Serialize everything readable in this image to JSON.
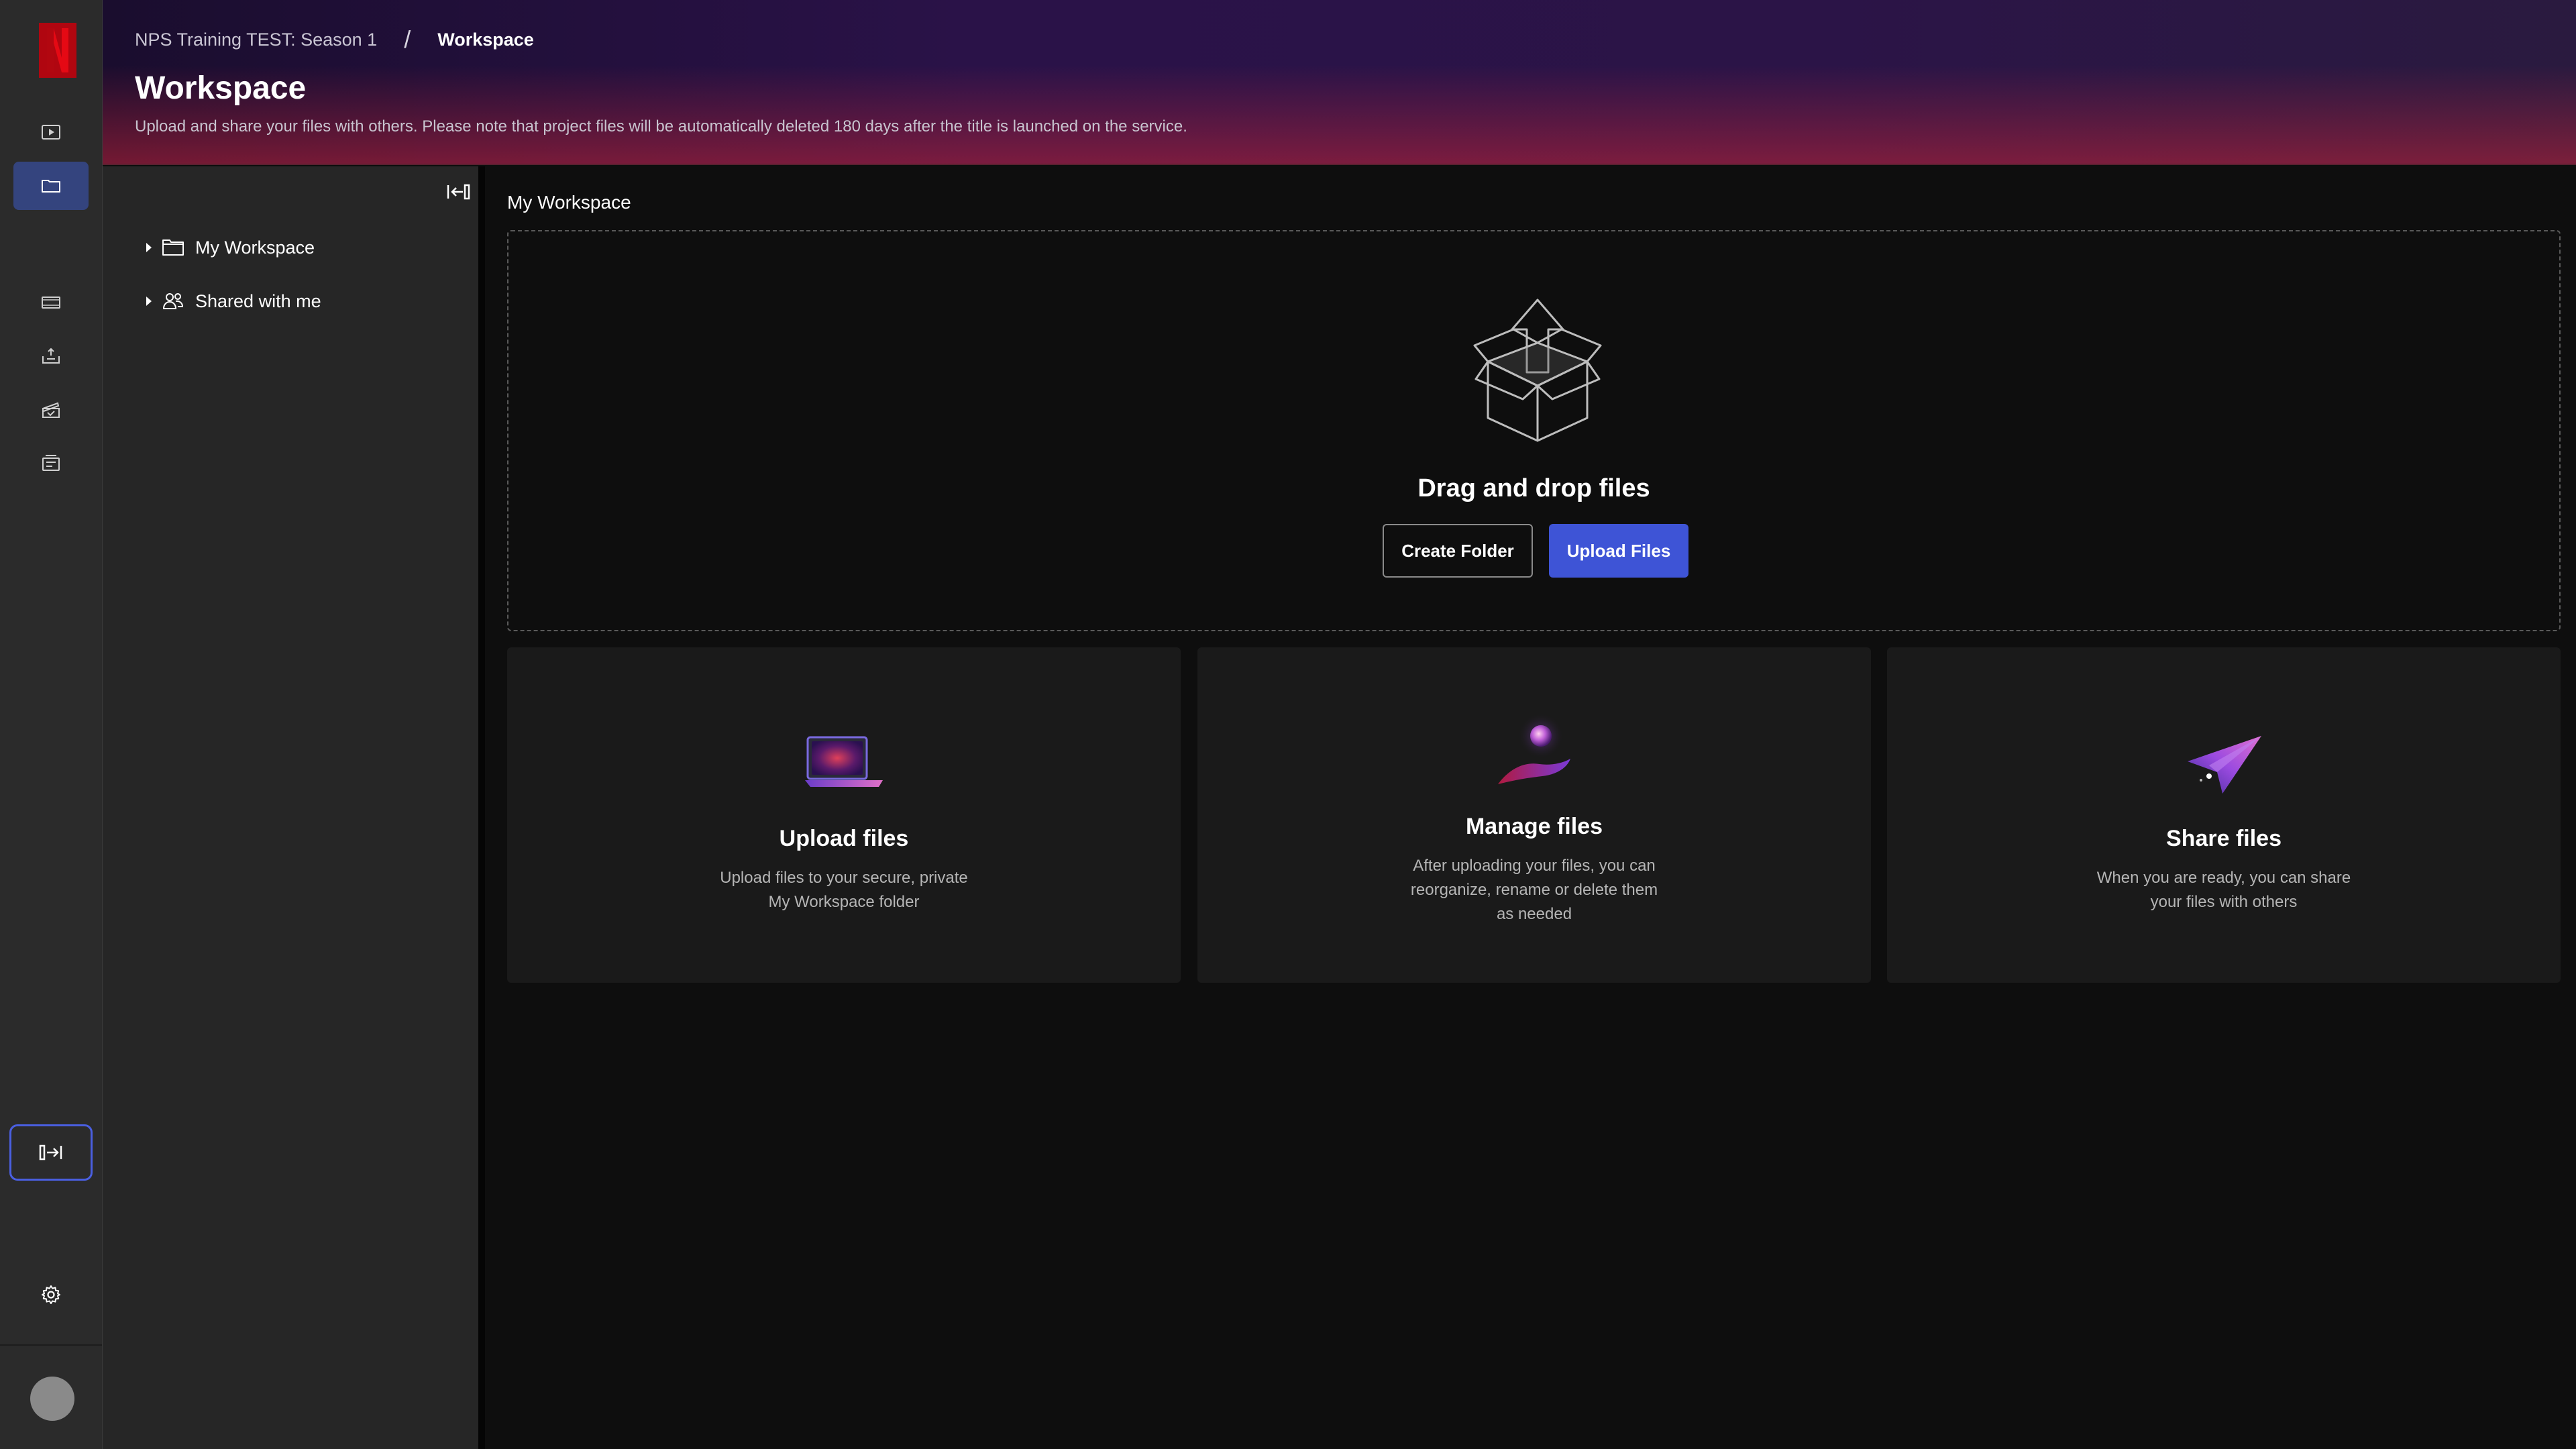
{
  "app": {
    "brand": "Netflix"
  },
  "rail": {
    "items": [
      {
        "name": "titles",
        "icon": "play-icon",
        "active": false
      },
      {
        "name": "workspace",
        "icon": "folder-icon",
        "active": true
      },
      {
        "name": "media",
        "icon": "film-strip-icon",
        "active": false
      },
      {
        "name": "deliveries",
        "icon": "upload-tray-icon",
        "active": false
      },
      {
        "name": "assets",
        "icon": "clapper-icon",
        "active": false
      },
      {
        "name": "tasks",
        "icon": "checklist-icon",
        "active": false
      }
    ],
    "toggle_icon": "expand-sidebar-icon",
    "settings_icon": "gear-icon"
  },
  "header": {
    "breadcrumb_parent": "NPS Training TEST: Season 1",
    "breadcrumb_separator": "/",
    "breadcrumb_current": "Workspace",
    "title": "Workspace",
    "subtitle": "Upload and share your files with others. Please note that project files will be automatically deleted 180 days after the title is launched on the service."
  },
  "tree": {
    "collapse_icon": "collapse-panel-icon",
    "items": [
      {
        "label": "My Workspace",
        "icon": "folder-icon"
      },
      {
        "label": "Shared with me",
        "icon": "shared-users-icon"
      }
    ]
  },
  "main": {
    "section_title": "My Workspace",
    "dropzone": {
      "title": "Drag and drop files",
      "create_folder_label": "Create Folder",
      "upload_files_label": "Upload Files"
    },
    "cards": [
      {
        "title": "Upload files",
        "desc_line1": "Upload files to your secure, private",
        "desc_line2": "My Workspace folder"
      },
      {
        "title": "Manage files",
        "desc_line1": "After uploading your files, you can",
        "desc_line2": "reorganize, rename or delete them",
        "desc_line3": "as needed"
      },
      {
        "title": "Share files",
        "desc_line1": "When you are ready, you can share",
        "desc_line2": "your files with others"
      }
    ]
  },
  "colors": {
    "accent": "#3e54d6",
    "rail_active": "#34447e",
    "brand_red": "#e50914"
  }
}
